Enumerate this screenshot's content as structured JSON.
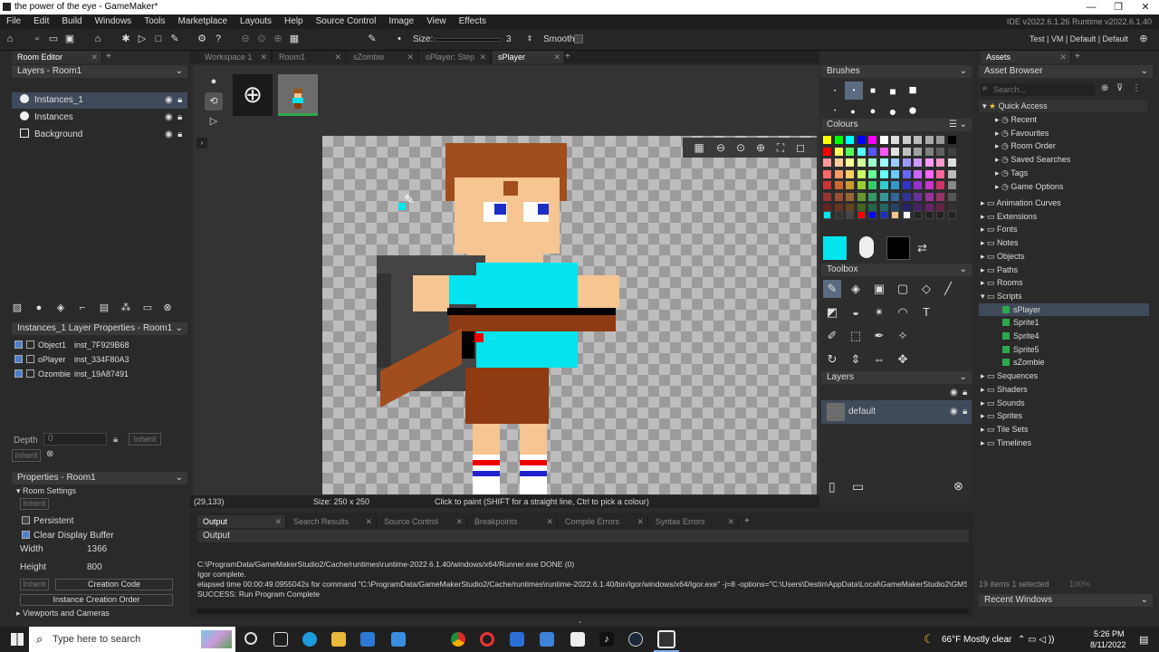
{
  "window": {
    "title": "the power of the eye - GameMaker*",
    "controls": {
      "minimize": "—",
      "maximize": "❐",
      "close": "✕"
    }
  },
  "menu": [
    "File",
    "Edit",
    "Build",
    "Windows",
    "Tools",
    "Marketplace",
    "Layouts",
    "Help",
    "Source Control",
    "Image",
    "View",
    "Effects"
  ],
  "ide_version": "IDE v2022.6.1.26  Runtime v2022.6.1.40",
  "toolbar": {
    "size_label": "Size:",
    "size_value": "3",
    "smooth_label": "Smooth",
    "config": "Test | VM | Default | Default"
  },
  "room_editor": {
    "tab": "Room Editor",
    "layers_header": "Layers - Room1",
    "layers": [
      "Instances_1",
      "Instances",
      "Background"
    ],
    "layer_props_header": "Instances_1 Layer Properties - Room1",
    "instances": [
      {
        "name": "Object1",
        "id": "inst_7F929B68"
      },
      {
        "name": "oPlayer",
        "id": "inst_334F80A3"
      },
      {
        "name": "Ozombie",
        "id": "inst_19A87491"
      }
    ],
    "depth_label": "Depth",
    "depth_value": "0",
    "inherit": "Inherit",
    "properties_header": "Properties - Room1",
    "room_settings": "Room Settings",
    "persistent": "Persistent",
    "clear_display": "Clear Display Buffer",
    "width_label": "Width",
    "width_value": "1366",
    "height_label": "Height",
    "height_value": "800",
    "creation_code": "Creation Code",
    "instance_creation_order": "Instance Creation Order",
    "viewports": "Viewports and Cameras"
  },
  "workspace_tabs": [
    "Workspace 1",
    "Room1",
    "sZombie",
    "oPlayer: Step",
    "sPlayer"
  ],
  "status": {
    "coords": "(29,133)",
    "size": "Size: 250 x 250",
    "hint": "Click to paint (SHIFT for a straight line, Ctrl to pick a colour)"
  },
  "right_panel": {
    "brushes": "Brushes",
    "colours": "Colours",
    "toolbox": "Toolbox",
    "layers": "Layers",
    "layer_default": "default",
    "primary_color": "#00e5ee",
    "secondary_color": "#000000"
  },
  "assets": {
    "tab": "Assets",
    "browser": "Asset Browser",
    "search_placeholder": "Search...",
    "quick_access": "Quick Access",
    "quick_items": [
      "Recent",
      "Favourites",
      "Room Order",
      "Saved Searches",
      "Tags",
      "Game Options"
    ],
    "groups_top": [
      "Animation Curves",
      "Extensions",
      "Fonts",
      "Notes",
      "Objects",
      "Paths",
      "Rooms",
      "Scripts"
    ],
    "scripts_children": [
      "sPlayer",
      "Sprite1",
      "Sprite4",
      "Sprite5",
      "sZombie"
    ],
    "groups_bottom": [
      "Sequences",
      "Shaders",
      "Sounds",
      "Sprites",
      "Tile Sets",
      "Timelines"
    ],
    "count": "19 items   1 selected",
    "zoom": "100%",
    "recent_windows": "Recent Windows"
  },
  "output": {
    "tabs": [
      "Output",
      "Search Results",
      "Source Control",
      "Breakpoints",
      "Compile Errors",
      "Syntax Errors"
    ],
    "title": "Output",
    "lines": [
      "C:\\ProgramData/GameMakerStudio2/Cache/runtimes\\runtime-2022.6.1.40/windows/x64/Runner.exe DONE (0)",
      "Igor complete.",
      "elapsed time 00:00:49.0955042s for command \"C:\\ProgramData/GameMakerStudio2/Cache/runtimes\\runtime-2022.6.1.40/bin/igor/windows/x64/Igor.exe\" -j=8 -options=\"C:\\Users\\Destin\\AppData\\Local\\GameMakerStudio2\\GMS",
      "SUCCESS: Run Program Complete"
    ]
  },
  "taskbar": {
    "search": "Type here to search",
    "weather": "66°F  Mostly clear",
    "time": "5:26 PM",
    "date": "8/11/2022"
  }
}
